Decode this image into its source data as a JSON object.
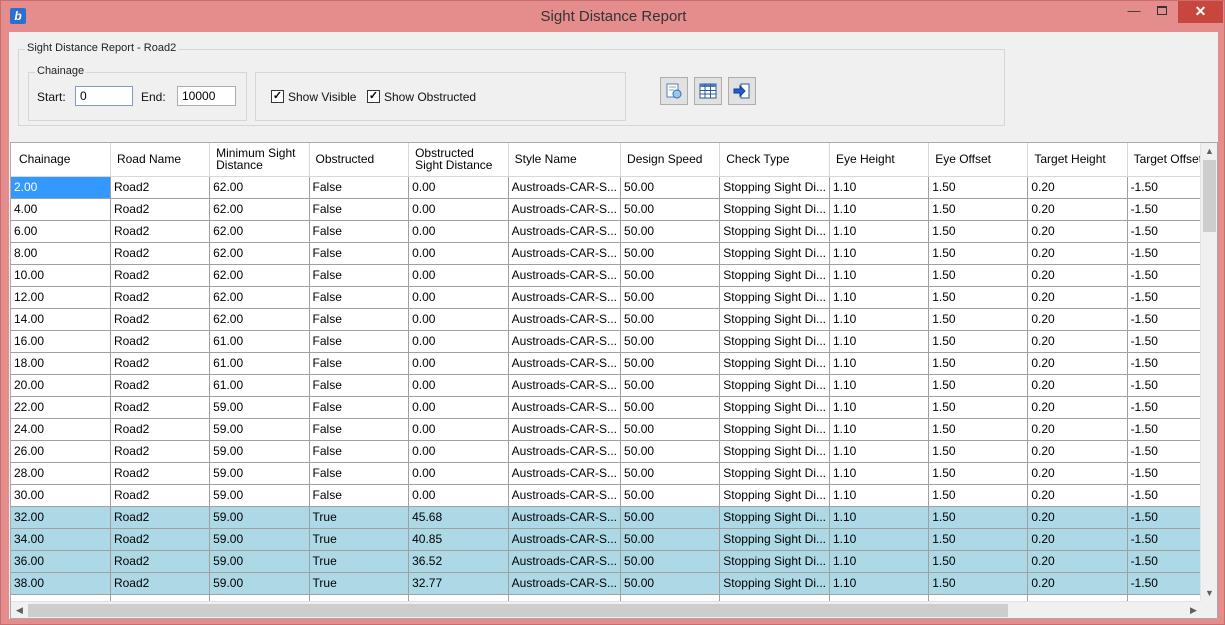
{
  "window": {
    "title": "Sight Distance Report"
  },
  "report_group": {
    "title": "Sight Distance Report - Road2"
  },
  "chainage": {
    "title": "Chainage",
    "start_label": "Start:",
    "start_value": "0",
    "end_label": "End:",
    "end_value": "10000"
  },
  "filters": {
    "show_visible": "Show Visible",
    "show_obstructed": "Show Obstructed"
  },
  "toolbar": {
    "icons": [
      "refresh-report-icon",
      "table-grid-icon",
      "export-icon"
    ]
  },
  "colors": {
    "obstructed_row": "#add8e6",
    "selected_cell": "#3399ff",
    "title_bar": "#e58c8c"
  },
  "table": {
    "columns": [
      "Chainage",
      "Road Name",
      "Minimum Sight Distance",
      "Obstructed",
      "Obstructed Sight Distance",
      "Style Name",
      "Design Speed",
      "Check Type",
      "Eye Height",
      "Eye Offset",
      "Target Height",
      "Target Offset"
    ],
    "rows": [
      [
        "2.00",
        "Road2",
        "62.00",
        "False",
        "0.00",
        "Austroads-CAR-S...",
        "50.00",
        "Stopping Sight Di...",
        "1.10",
        "1.50",
        "0.20",
        "-1.50"
      ],
      [
        "4.00",
        "Road2",
        "62.00",
        "False",
        "0.00",
        "Austroads-CAR-S...",
        "50.00",
        "Stopping Sight Di...",
        "1.10",
        "1.50",
        "0.20",
        "-1.50"
      ],
      [
        "6.00",
        "Road2",
        "62.00",
        "False",
        "0.00",
        "Austroads-CAR-S...",
        "50.00",
        "Stopping Sight Di...",
        "1.10",
        "1.50",
        "0.20",
        "-1.50"
      ],
      [
        "8.00",
        "Road2",
        "62.00",
        "False",
        "0.00",
        "Austroads-CAR-S...",
        "50.00",
        "Stopping Sight Di...",
        "1.10",
        "1.50",
        "0.20",
        "-1.50"
      ],
      [
        "10.00",
        "Road2",
        "62.00",
        "False",
        "0.00",
        "Austroads-CAR-S...",
        "50.00",
        "Stopping Sight Di...",
        "1.10",
        "1.50",
        "0.20",
        "-1.50"
      ],
      [
        "12.00",
        "Road2",
        "62.00",
        "False",
        "0.00",
        "Austroads-CAR-S...",
        "50.00",
        "Stopping Sight Di...",
        "1.10",
        "1.50",
        "0.20",
        "-1.50"
      ],
      [
        "14.00",
        "Road2",
        "62.00",
        "False",
        "0.00",
        "Austroads-CAR-S...",
        "50.00",
        "Stopping Sight Di...",
        "1.10",
        "1.50",
        "0.20",
        "-1.50"
      ],
      [
        "16.00",
        "Road2",
        "61.00",
        "False",
        "0.00",
        "Austroads-CAR-S...",
        "50.00",
        "Stopping Sight Di...",
        "1.10",
        "1.50",
        "0.20",
        "-1.50"
      ],
      [
        "18.00",
        "Road2",
        "61.00",
        "False",
        "0.00",
        "Austroads-CAR-S...",
        "50.00",
        "Stopping Sight Di...",
        "1.10",
        "1.50",
        "0.20",
        "-1.50"
      ],
      [
        "20.00",
        "Road2",
        "61.00",
        "False",
        "0.00",
        "Austroads-CAR-S...",
        "50.00",
        "Stopping Sight Di...",
        "1.10",
        "1.50",
        "0.20",
        "-1.50"
      ],
      [
        "22.00",
        "Road2",
        "59.00",
        "False",
        "0.00",
        "Austroads-CAR-S...",
        "50.00",
        "Stopping Sight Di...",
        "1.10",
        "1.50",
        "0.20",
        "-1.50"
      ],
      [
        "24.00",
        "Road2",
        "59.00",
        "False",
        "0.00",
        "Austroads-CAR-S...",
        "50.00",
        "Stopping Sight Di...",
        "1.10",
        "1.50",
        "0.20",
        "-1.50"
      ],
      [
        "26.00",
        "Road2",
        "59.00",
        "False",
        "0.00",
        "Austroads-CAR-S...",
        "50.00",
        "Stopping Sight Di...",
        "1.10",
        "1.50",
        "0.20",
        "-1.50"
      ],
      [
        "28.00",
        "Road2",
        "59.00",
        "False",
        "0.00",
        "Austroads-CAR-S...",
        "50.00",
        "Stopping Sight Di...",
        "1.10",
        "1.50",
        "0.20",
        "-1.50"
      ],
      [
        "30.00",
        "Road2",
        "59.00",
        "False",
        "0.00",
        "Austroads-CAR-S...",
        "50.00",
        "Stopping Sight Di...",
        "1.10",
        "1.50",
        "0.20",
        "-1.50"
      ],
      [
        "32.00",
        "Road2",
        "59.00",
        "True",
        "45.68",
        "Austroads-CAR-S...",
        "50.00",
        "Stopping Sight Di...",
        "1.10",
        "1.50",
        "0.20",
        "-1.50"
      ],
      [
        "34.00",
        "Road2",
        "59.00",
        "True",
        "40.85",
        "Austroads-CAR-S...",
        "50.00",
        "Stopping Sight Di...",
        "1.10",
        "1.50",
        "0.20",
        "-1.50"
      ],
      [
        "36.00",
        "Road2",
        "59.00",
        "True",
        "36.52",
        "Austroads-CAR-S...",
        "50.00",
        "Stopping Sight Di...",
        "1.10",
        "1.50",
        "0.20",
        "-1.50"
      ],
      [
        "38.00",
        "Road2",
        "59.00",
        "True",
        "32.77",
        "Austroads-CAR-S...",
        "50.00",
        "Stopping Sight Di...",
        "1.10",
        "1.50",
        "0.20",
        "-1.50"
      ],
      [
        "",
        "",
        "",
        "",
        "",
        "",
        "",
        "",
        "",
        "",
        "",
        ""
      ]
    ]
  }
}
